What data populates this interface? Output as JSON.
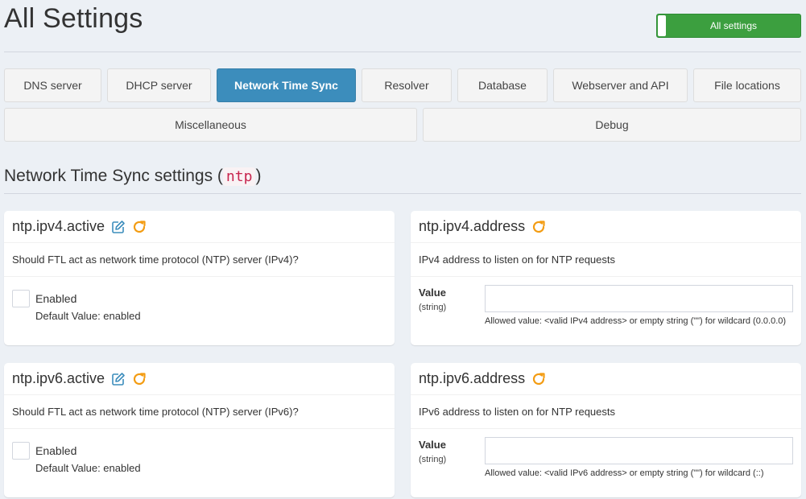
{
  "header": {
    "title": "All Settings",
    "toggle_label": "All settings"
  },
  "tabs": [
    {
      "label": "DNS server",
      "active": false
    },
    {
      "label": "DHCP server",
      "active": false
    },
    {
      "label": "Network Time Sync",
      "active": true
    },
    {
      "label": "Resolver",
      "active": false
    },
    {
      "label": "Database",
      "active": false
    },
    {
      "label": "Webserver and API",
      "active": false
    },
    {
      "label": "File locations",
      "active": false
    },
    {
      "label": "Miscellaneous",
      "active": false
    },
    {
      "label": "Debug",
      "active": false
    }
  ],
  "section": {
    "title_prefix": "Network Time Sync settings (",
    "code": "ntp",
    "title_suffix": ")"
  },
  "cards": {
    "ipv4_active": {
      "title": "ntp.ipv4.active",
      "description": "Should FTL act as network time protocol (NTP) server (IPv4)?",
      "checkbox_label": "Enabled",
      "default_value": "Default Value: enabled"
    },
    "ipv4_address": {
      "title": "ntp.ipv4.address",
      "description": "IPv4 address to listen on for NTP requests",
      "value_label": "Value",
      "value_type": "(string)",
      "value": "",
      "help": "Allowed value: <valid IPv4 address> or empty string (\"\") for wildcard (0.0.0.0)"
    },
    "ipv6_active": {
      "title": "ntp.ipv6.active",
      "description": "Should FTL act as network time protocol (NTP) server (IPv6)?",
      "checkbox_label": "Enabled",
      "default_value": "Default Value: enabled"
    },
    "ipv6_address": {
      "title": "ntp.ipv6.address",
      "description": "IPv6 address to listen on for NTP requests",
      "value_label": "Value",
      "value_type": "(string)",
      "value": "",
      "help": "Allowed value: <valid IPv6 address> or empty string (\"\") for wildcard (::)"
    }
  },
  "icons": {
    "edit": "edit-icon",
    "reset": "reset-icon"
  },
  "colors": {
    "active_tab": "#3c8dbc",
    "toggle_on": "#3c9f3f",
    "edit_icon": "#3c8dbc",
    "reset_icon": "#f39c12",
    "code_text": "#c7254e"
  }
}
